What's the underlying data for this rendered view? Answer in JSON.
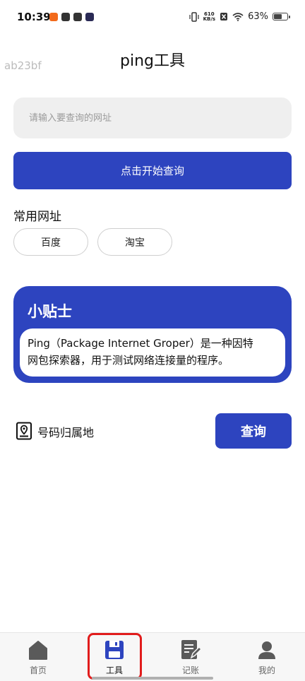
{
  "status_bar": {
    "time": "10:39",
    "net_speed_value": "610",
    "net_speed_unit": "KB/s",
    "battery_percent": "63%",
    "battery_level": 0.63
  },
  "watermark": "ab23bf",
  "page": {
    "title": "ping工具"
  },
  "search": {
    "placeholder": "请输入要查询的网址",
    "value": ""
  },
  "start_button": {
    "label": "点击开始查询"
  },
  "common_urls": {
    "title": "常用网址",
    "items": [
      {
        "label": "百度"
      },
      {
        "label": "淘宝"
      }
    ]
  },
  "tips": {
    "title": "小贴士",
    "line1": "Ping（Package Internet Groper）是一种因特",
    "line2": "网包探索器，用于测试网络连接量的程序。"
  },
  "phone_lookup": {
    "label": "号码归属地",
    "button_label": "查询"
  },
  "bottom_nav": {
    "items": [
      {
        "label": "首页",
        "icon": "home-icon"
      },
      {
        "label": "工具",
        "icon": "save-icon",
        "active": true
      },
      {
        "label": "记账",
        "icon": "edit-note-icon"
      },
      {
        "label": "我的",
        "icon": "user-icon"
      }
    ]
  },
  "colors": {
    "primary": "#2d44bf",
    "input_bg": "#efefef",
    "highlight": "#e11c1c",
    "nav_bg": "#f7f7f7"
  }
}
